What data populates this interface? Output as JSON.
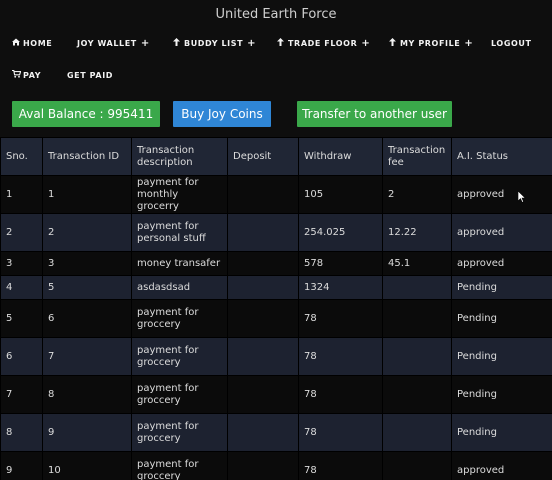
{
  "site_title": "United Earth Force",
  "nav": {
    "home": "HOME",
    "joy_wallet": "JOY WALLET",
    "buddy_list": "BUDDY LIST",
    "trade_floor": "TRADE FLOOR",
    "my_profile": "MY PROFILE",
    "logout": "LOGOUT",
    "pay": "PAY",
    "get_paid": "GET PAID",
    "plus": "+",
    "icons": {
      "home": "home-icon",
      "pay": "cart-icon",
      "up": "arrow-up-icon"
    }
  },
  "actions": {
    "balance": "Aval Balance : 995411",
    "buy": "Buy Joy Coins",
    "transfer": "Transfer to another user",
    "colors": {
      "green": "#3aa84a",
      "blue": "#2f86d6"
    }
  },
  "table": {
    "headers": [
      "Sno.",
      "Transaction ID",
      "Transaction description",
      "Deposit",
      "Withdraw",
      "Transaction fee",
      "A.I. Status"
    ],
    "rows": [
      [
        "1",
        "1",
        "payment for monthly grocerry",
        "",
        "105",
        "2",
        "approved"
      ],
      [
        "2",
        "2",
        "payment for personal stuff",
        "",
        "254.025",
        "12.22",
        "approved"
      ],
      [
        "3",
        "3",
        "money transafer",
        "",
        "578",
        "45.1",
        "approved"
      ],
      [
        "4",
        "5",
        "asdasdsad",
        "",
        "1324",
        "",
        "Pending"
      ],
      [
        "5",
        "6",
        "payment for groccery",
        "",
        "78",
        "",
        "Pending"
      ],
      [
        "6",
        "7",
        "payment for groccery",
        "",
        "78",
        "",
        "Pending"
      ],
      [
        "7",
        "8",
        "payment for groccery",
        "",
        "78",
        "",
        "Pending"
      ],
      [
        "8",
        "9",
        "payment for groccery",
        "",
        "78",
        "",
        "Pending"
      ],
      [
        "9",
        "10",
        "payment for groccery",
        "",
        "78",
        "",
        "approved"
      ]
    ]
  }
}
